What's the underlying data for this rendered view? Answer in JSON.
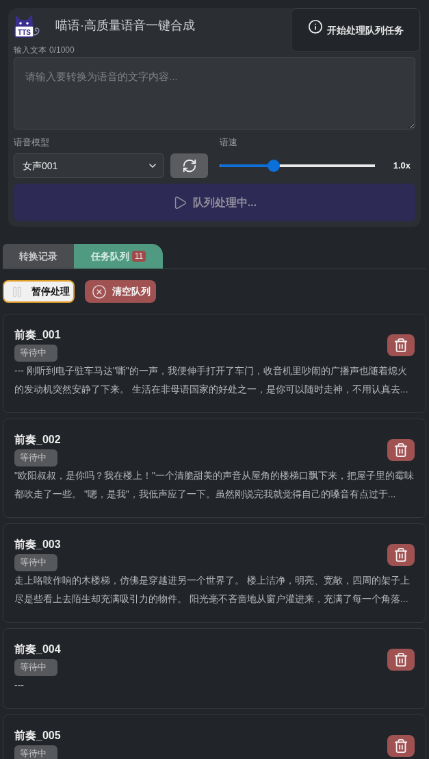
{
  "header": {
    "logo_text": "TTS",
    "title": "喵语·高质量语音一键合成"
  },
  "tooltip": {
    "text": "开始处理队列任务"
  },
  "text_input": {
    "label": "输入文本",
    "count": "0/1000",
    "placeholder": "请输入要转换为语音的文字内容..."
  },
  "voice_model": {
    "label": "语音模型",
    "value": "女声001"
  },
  "speed": {
    "label": "语速",
    "level": 0.35,
    "reading": "1.0x"
  },
  "process_button": {
    "label": "队列处理中...",
    "disabled": true
  },
  "tabs": [
    {
      "label": "转换记录",
      "selected": false
    },
    {
      "label": "任务队列",
      "badge": "11",
      "selected": true
    }
  ],
  "queue_actions": [
    {
      "kind": "pause",
      "label": "暂停处理"
    },
    {
      "kind": "clear",
      "label": "清空队列"
    }
  ],
  "tasks": [
    {
      "title": "前奏_001",
      "status": "等待中",
      "text": "--- 刚听到电子驻车马达\"嘶\"的一声，我便伸手打开了车门，收音机里吵闹的广播声也随着熄火的发动机突然安静了下来。 生活在非母语国家的好处之一，是你可以随时走神，不用认真去..."
    },
    {
      "title": "前奏_002",
      "status": "等待中",
      "text": "\"欧阳叔叔，是你吗？我在楼上！\"一个清脆甜美的声音从屋角的楼梯口飘下来，把屋子里的霉味都吹走了一些。 \"嗯，是我\"，我低声应了一下。虽然刚说完我就觉得自己的嗓音有点过于..."
    },
    {
      "title": "前奏_003",
      "status": "等待中",
      "text": "走上咯吱作响的木楼梯，仿佛是穿越进另一个世界了。 楼上洁净，明亮、宽敞，四周的架子上尽是些看上去陌生却充满吸引力的物件。 阳光毫不吝啬地从窗户灌进来，充满了每一个角落..."
    },
    {
      "title": "前奏_004",
      "status": "等待中",
      "text": "---"
    },
    {
      "title": "前奏_005",
      "status": "等待中"
    }
  ]
}
